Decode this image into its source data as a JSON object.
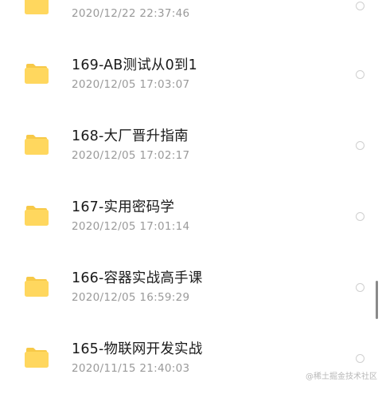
{
  "folders": [
    {
      "name": "",
      "time": "2020/12/22 22:37:46"
    },
    {
      "name": "169-AB测试从0到1",
      "time": "2020/12/05 17:03:07"
    },
    {
      "name": "168-大厂晋升指南",
      "time": "2020/12/05 17:02:17"
    },
    {
      "name": "167-实用密码学",
      "time": "2020/12/05 17:01:14"
    },
    {
      "name": "166-容器实战高手课",
      "time": "2020/12/05 16:59:29"
    },
    {
      "name": "165-物联网开发实战",
      "time": "2020/11/15 21:40:03"
    }
  ],
  "icons": {
    "folder": "folder-icon",
    "select": "radio-circle"
  },
  "colors": {
    "folder": "#FFD75E",
    "folder_tab": "#F7C948",
    "text_primary": "#1A1A1A",
    "text_secondary": "#9A9A9A",
    "radio_border": "#CFCFCF",
    "scrollbar": "#8A8A8A"
  },
  "watermark": "@稀土掘金技术社区"
}
